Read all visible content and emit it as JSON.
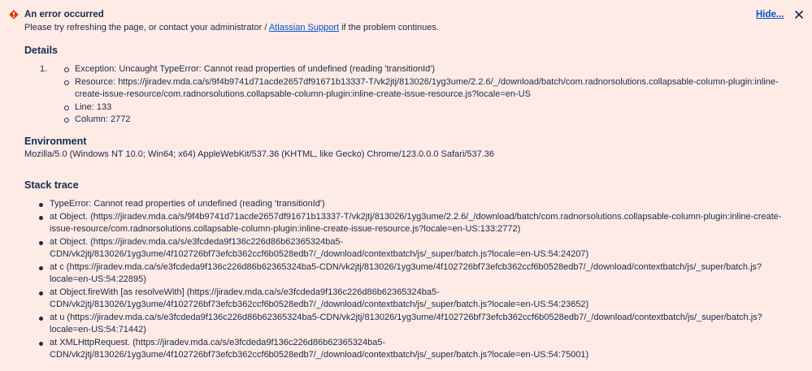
{
  "banner": {
    "title": "An error occurred",
    "message_before": "Please try refreshing the page, or contact your administrator / ",
    "support_link": "Atlassian Support",
    "message_after": " if the problem continues.",
    "hide_label": "Hide...",
    "icons": {
      "error": "error-icon",
      "close": "close-icon"
    },
    "colors": {
      "background": "#ffebe6",
      "error": "#de350b",
      "link": "#0052cc",
      "text": "#172b4d"
    }
  },
  "details": {
    "heading": "Details",
    "item_number": "1.",
    "items": [
      "Exception: Uncaught TypeError: Cannot read properties of undefined (reading 'transitionId')",
      "Resource: https://jiradev.mda.ca/s/9f4b9741d71acde2657df91671b13337-T/vk2jtj/813026/1yg3ume/2.2.6/_/download/batch/com.radnorsolutions.collapsable-column-plugin:inline-create-issue-resource/com.radnorsolutions.collapsable-column-plugin:inline-create-issue-resource.js?locale=en-US",
      "Line: 133",
      "Column: 2772"
    ]
  },
  "environment": {
    "heading": "Environment",
    "user_agent": "Mozilla/5.0 (Windows NT 10.0; Win64; x64) AppleWebKit/537.36 (KHTML, like Gecko) Chrome/123.0.0.0 Safari/537.36"
  },
  "stack_trace": {
    "heading": "Stack trace",
    "items": [
      "TypeError: Cannot read properties of undefined (reading 'transitionId')",
      "at Object. (https://jiradev.mda.ca/s/9f4b9741d71acde2657df91671b13337-T/vk2jtj/813026/1yg3ume/2.2.6/_/download/batch/com.radnorsolutions.collapsable-column-plugin:inline-create-issue-resource/com.radnorsolutions.collapsable-column-plugin:inline-create-issue-resource.js?locale=en-US:133:2772)",
      "at Object. (https://jiradev.mda.ca/s/e3fcdeda9f136c226d86b62365324ba5-CDN/vk2jtj/813026/1yg3ume/4f102726bf73efcb362ccf6b0528edb7/_/download/contextbatch/js/_super/batch.js?locale=en-US:54:24207)",
      "at c (https://jiradev.mda.ca/s/e3fcdeda9f136c226d86b62365324ba5-CDN/vk2jtj/813026/1yg3ume/4f102726bf73efcb362ccf6b0528edb7/_/download/contextbatch/js/_super/batch.js?locale=en-US:54:22895)",
      "at Object.fireWith [as resolveWith] (https://jiradev.mda.ca/s/e3fcdeda9f136c226d86b62365324ba5-CDN/vk2jtj/813026/1yg3ume/4f102726bf73efcb362ccf6b0528edb7/_/download/contextbatch/js/_super/batch.js?locale=en-US:54:23652)",
      "at u (https://jiradev.mda.ca/s/e3fcdeda9f136c226d86b62365324ba5-CDN/vk2jtj/813026/1yg3ume/4f102726bf73efcb362ccf6b0528edb7/_/download/contextbatch/js/_super/batch.js?locale=en-US:54:71442)",
      "at XMLHttpRequest. (https://jiradev.mda.ca/s/e3fcdeda9f136c226d86b62365324ba5-CDN/vk2jtj/813026/1yg3ume/4f102726bf73efcb362ccf6b0528edb7/_/download/contextbatch/js/_super/batch.js?locale=en-US:54:75001)"
    ]
  }
}
